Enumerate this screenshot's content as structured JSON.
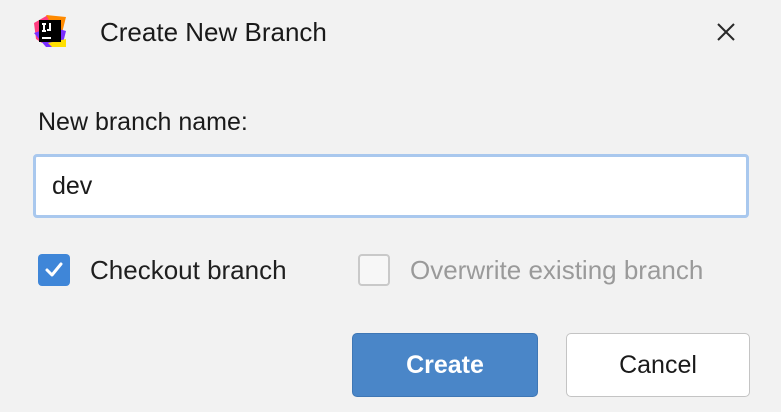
{
  "window": {
    "title": "Create New Branch",
    "app_icon": "intellij-idea-icon",
    "close_icon": "close-icon"
  },
  "form": {
    "branch_name_label": "New branch name:",
    "branch_name_value": "dev",
    "checkout_branch": {
      "label": "Checkout branch",
      "checked": true,
      "enabled": true
    },
    "overwrite_branch": {
      "label": "Overwrite existing branch",
      "checked": false,
      "enabled": false
    }
  },
  "buttons": {
    "create": "Create",
    "cancel": "Cancel"
  },
  "colors": {
    "accent": "#3f86d8",
    "primary_button": "#4a86c8",
    "input_focus_border": "#a9c8ee",
    "background": "#f2f2f2"
  }
}
